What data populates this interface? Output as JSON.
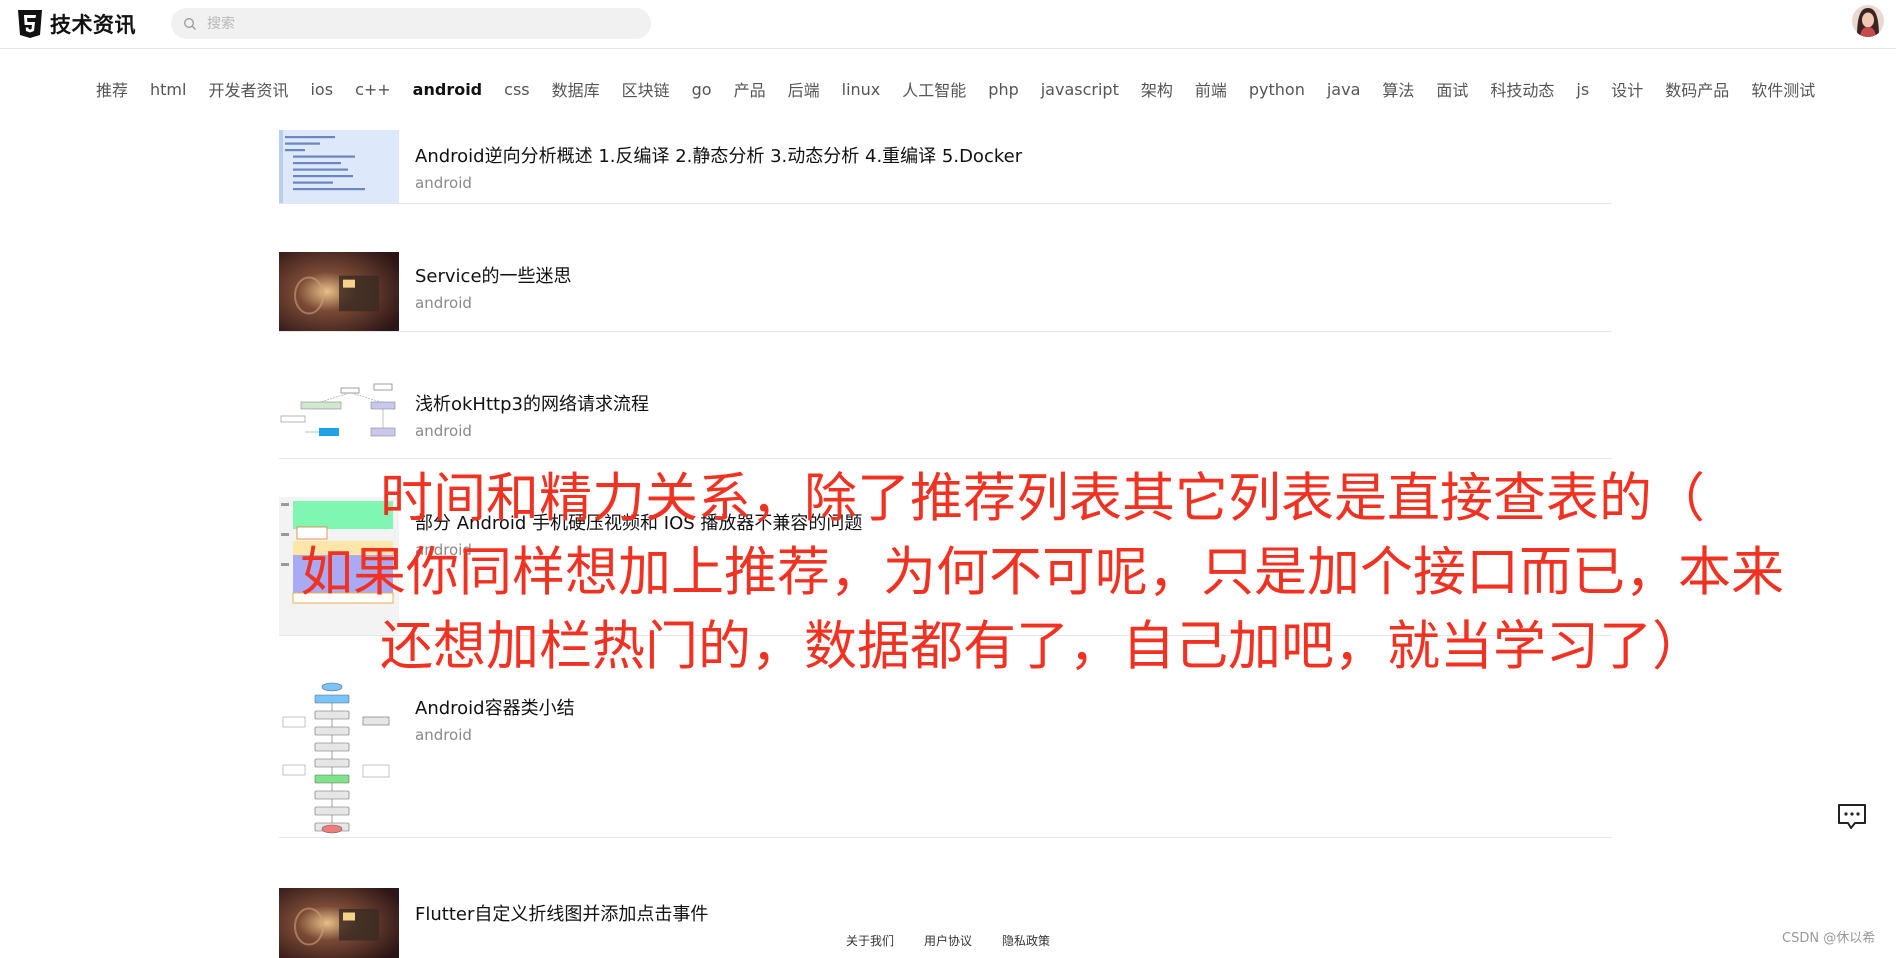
{
  "header": {
    "logo_text": "技术资讯",
    "search_placeholder": "搜索"
  },
  "nav": [
    {
      "label": "推荐",
      "active": false
    },
    {
      "label": "html",
      "active": false
    },
    {
      "label": "开发者资讯",
      "active": false
    },
    {
      "label": "ios",
      "active": false
    },
    {
      "label": "c++",
      "active": false
    },
    {
      "label": "android",
      "active": true
    },
    {
      "label": "css",
      "active": false
    },
    {
      "label": "数据库",
      "active": false
    },
    {
      "label": "区块链",
      "active": false
    },
    {
      "label": "go",
      "active": false
    },
    {
      "label": "产品",
      "active": false
    },
    {
      "label": "后端",
      "active": false
    },
    {
      "label": "linux",
      "active": false
    },
    {
      "label": "人工智能",
      "active": false
    },
    {
      "label": "php",
      "active": false
    },
    {
      "label": "javascript",
      "active": false
    },
    {
      "label": "架构",
      "active": false
    },
    {
      "label": "前端",
      "active": false
    },
    {
      "label": "python",
      "active": false
    },
    {
      "label": "java",
      "active": false
    },
    {
      "label": "算法",
      "active": false
    },
    {
      "label": "面试",
      "active": false
    },
    {
      "label": "科技动态",
      "active": false
    },
    {
      "label": "js",
      "active": false
    },
    {
      "label": "设计",
      "active": false
    },
    {
      "label": "数码产品",
      "active": false
    },
    {
      "label": "软件测试",
      "active": false
    }
  ],
  "articles": [
    {
      "title": "Android逆向分析概述 1.反编译 2.静态分析 3.动态分析 4.重编译 5.Docker",
      "tag": "android",
      "thumb": "code"
    },
    {
      "title": "Service的一些迷思",
      "tag": "android",
      "thumb": "scene"
    },
    {
      "title": "浅析okHttp3的网络请求流程",
      "tag": "android",
      "thumb": "diagram"
    },
    {
      "title": "部分 Android 手机硬压视频和 IOS 播放器不兼容的问题",
      "tag": "android",
      "thumb": "colorblocks"
    },
    {
      "title": "Android容器类小结",
      "tag": "android",
      "thumb": "flowchart"
    },
    {
      "title": "Flutter自定义折线图并添加点击事件",
      "tag": "",
      "thumb": "scene"
    }
  ],
  "overlay_lines": [
    "时间和精力关系，除了推荐列表其它列表是直接查表的（",
    "如果你同样想加上推荐，为何不可呢，只是加个接口而已，本来",
    "还想加栏热门的，数据都有了，自己加吧，就当学习了）"
  ],
  "footer": {
    "about": "关于我们",
    "agreement": "用户协议",
    "privacy": "隐私政策"
  },
  "watermark": "CSDN @休以希",
  "colors": {
    "overlay_text": "#f03222",
    "active_nav": "#111111",
    "nav": "#555555"
  }
}
